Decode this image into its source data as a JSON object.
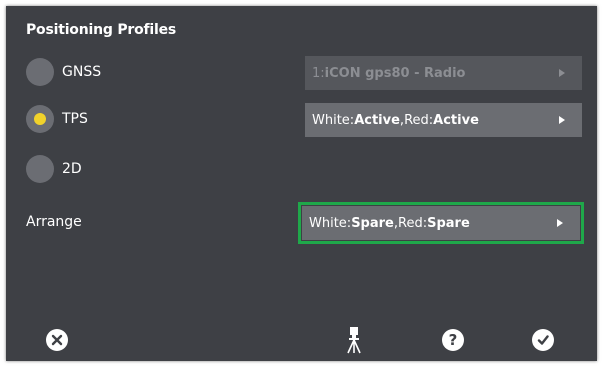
{
  "title": "Positioning Profiles",
  "radio_options": [
    {
      "label": "GNSS",
      "selected": false
    },
    {
      "label": "TPS",
      "selected": true
    },
    {
      "label": "2D",
      "selected": false
    }
  ],
  "gnss_selector": {
    "prefix": "1: ",
    "value": "iCON gps80 - Radio",
    "enabled": false
  },
  "tps_selector": {
    "white_label": "White: ",
    "white_value": "Active",
    "sep": ", ",
    "red_label": "Red: ",
    "red_value": "Active"
  },
  "arrange": {
    "label": "Arrange",
    "white_label": "White: ",
    "white_value": "Spare",
    "sep": ", ",
    "red_label": "Red: ",
    "red_value": "Spare"
  },
  "colors": {
    "background": "#3e4045",
    "selected_radio": "#f1d22b",
    "highlight": "#1fa84a"
  },
  "toolbar": {
    "cancel_icon": "close-icon",
    "instrument_icon": "tripod-icon",
    "help_glyph": "?",
    "confirm_icon": "check-icon"
  }
}
